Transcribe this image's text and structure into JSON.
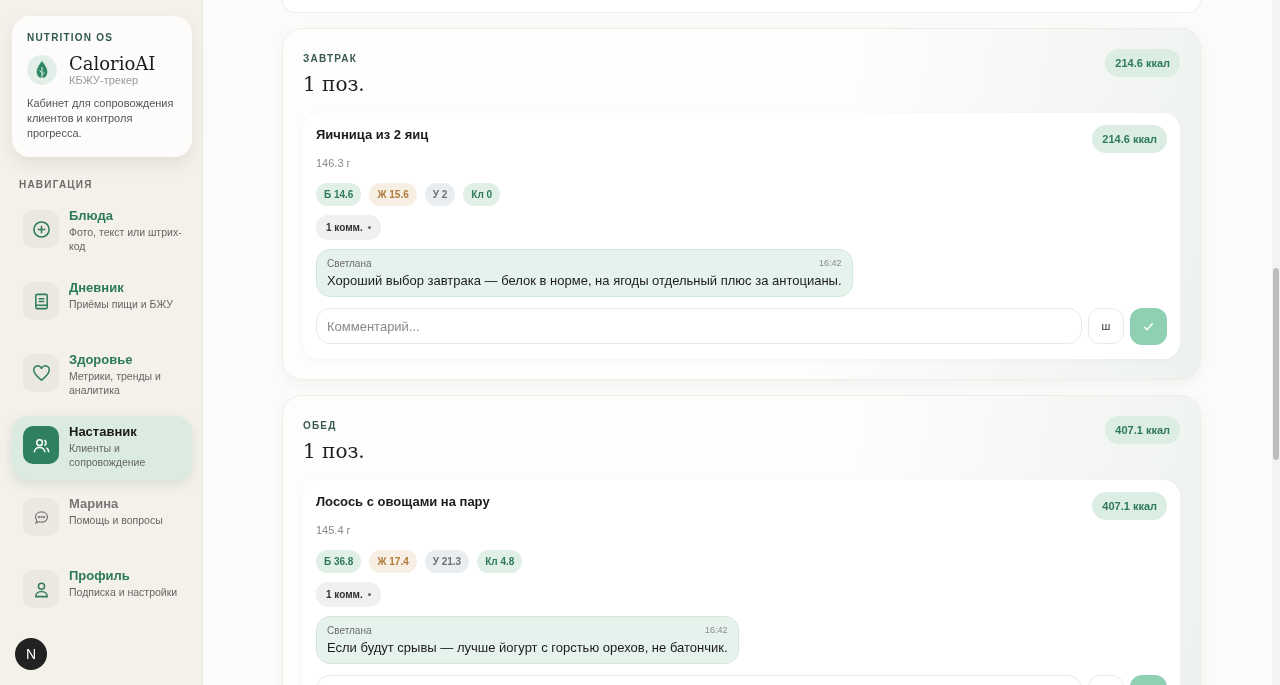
{
  "brand": {
    "eyebrow": "NUTRITION OS",
    "name": "CalorioAI",
    "subtitle": "КБЖУ-трекер",
    "description": "Кабинет для сопровождения клиентов и контроля прогресса."
  },
  "nav": {
    "heading": "НАВИГАЦИЯ",
    "items": [
      {
        "kind": "add",
        "title": "Блюда",
        "subtitle": "Фото, текст или штрих-код",
        "selected": false,
        "disabled": false
      },
      {
        "kind": "diary",
        "title": "Дневник",
        "subtitle": "Приёмы пищи и БЖУ",
        "selected": false,
        "disabled": false
      },
      {
        "kind": "health",
        "title": "Здоровье",
        "subtitle": "Метрики, тренды и аналитика",
        "selected": false,
        "disabled": false
      },
      {
        "kind": "mentor",
        "title": "Наставник",
        "subtitle": "Клиенты и сопровождение",
        "selected": true,
        "disabled": false
      },
      {
        "kind": "support",
        "title": "Марина",
        "subtitle": "Помощь и вопросы",
        "selected": false,
        "disabled": true
      },
      {
        "kind": "profile",
        "title": "Профиль",
        "subtitle": "Подписка и настройки",
        "selected": false,
        "disabled": false
      }
    ]
  },
  "avatar": "N",
  "meals": [
    {
      "label": "ЗАВТРАК",
      "count": "1 поз.",
      "kcal": "214.6 ккал",
      "items": [
        {
          "name": "Яичница из 2 яиц",
          "kcal": "214.6 ккал",
          "weight": "146.3 г",
          "macros": [
            {
              "kind": "protein",
              "text": "Б 14.6"
            },
            {
              "kind": "fat",
              "text": "Ж 15.6"
            },
            {
              "kind": "carb",
              "text": "У 2"
            },
            {
              "kind": "fiber",
              "text": "Кл 0"
            }
          ],
          "comments_count": "1 комм.",
          "comments": [
            {
              "author": "Светлана",
              "time": "16:42",
              "text": "Хороший выбор завтрака — белок в норме, на ягоды отдельный плюс за антоцианы."
            }
          ],
          "composer": {
            "placeholder": "Комментарий...",
            "button": "ш"
          }
        }
      ]
    },
    {
      "label": "ОБЕД",
      "count": "1 поз.",
      "kcal": "407.1 ккал",
      "items": [
        {
          "name": "Лосось с овощами на пару",
          "kcal": "407.1 ккал",
          "weight": "145.4 г",
          "macros": [
            {
              "kind": "protein",
              "text": "Б 36.8"
            },
            {
              "kind": "fat",
              "text": "Ж 17.4"
            },
            {
              "kind": "carb",
              "text": "У 21.3"
            },
            {
              "kind": "fiber",
              "text": "Кл 4.8"
            }
          ],
          "comments_count": "1 комм.",
          "comments": [
            {
              "author": "Светлана",
              "time": "16:42",
              "text": "Если будут срывы — лучше йогурт с горстью орехов, не батончик."
            }
          ]
        }
      ]
    }
  ]
}
